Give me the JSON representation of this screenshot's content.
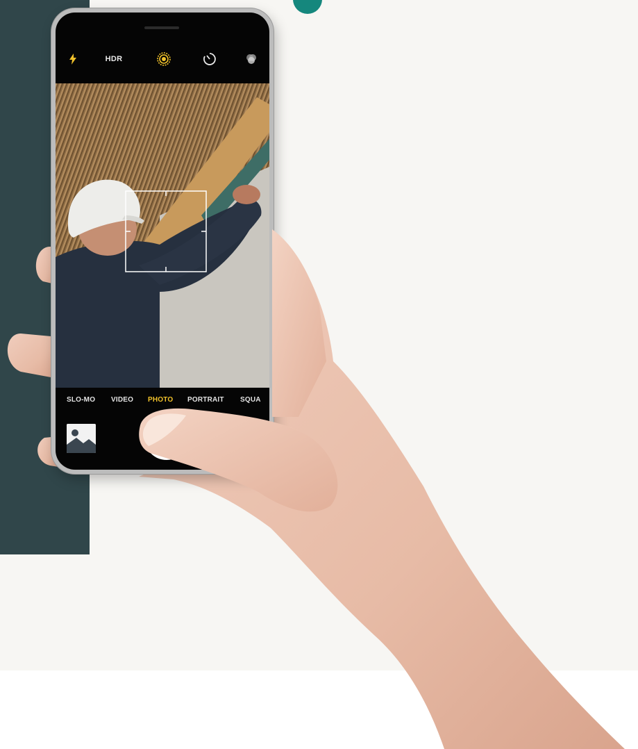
{
  "camera": {
    "top_controls": {
      "flash_icon": "lightning-icon",
      "hdr_label": "HDR",
      "live_photo_icon": "live-photo-icon",
      "timer_icon": "timer-icon",
      "filters_icon": "filters-icon"
    },
    "modes": [
      "SLO-MO",
      "VIDEO",
      "PHOTO",
      "PORTRAIT",
      "SQUA"
    ],
    "active_mode": "PHOTO",
    "gallery_icon": "gallery-thumbnail-icon",
    "shutter_icon": "shutter-button",
    "focus_icon": "focus-box-icon"
  },
  "colors": {
    "accent_yellow": "#f1c22b",
    "dark_strip": "#30464a",
    "teal": "#15877d",
    "background": "#f7f6f3"
  }
}
